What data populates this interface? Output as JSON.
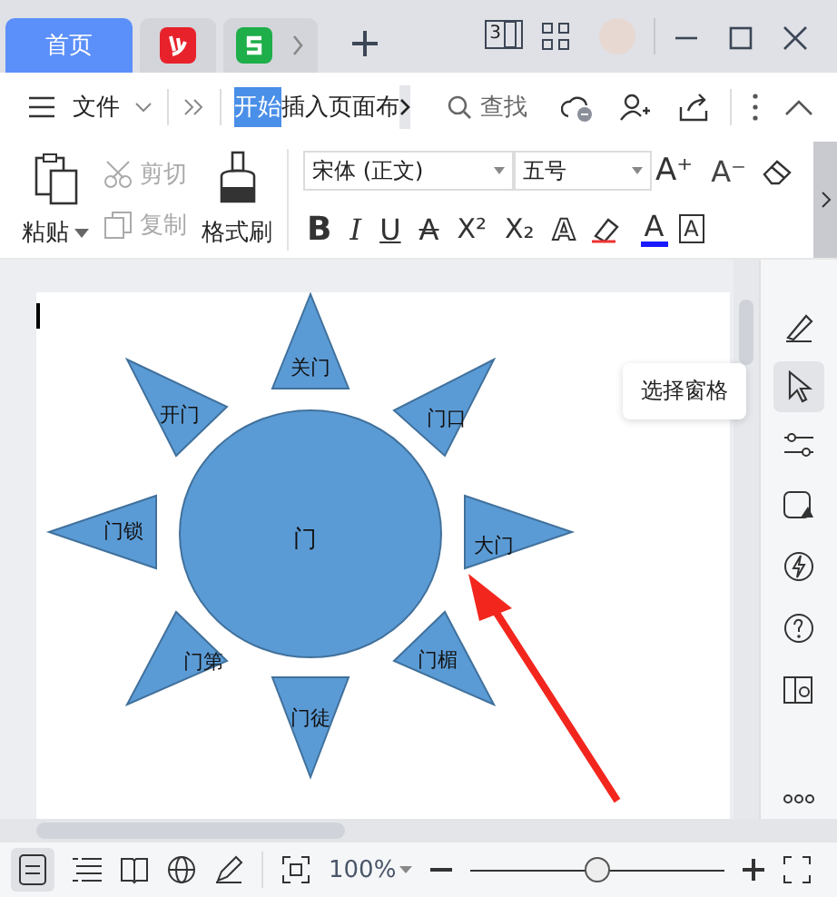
{
  "tab_bar": {
    "tabs": [
      {
        "kind": "label",
        "label": "首页",
        "selected": true
      },
      {
        "kind": "pdf",
        "selected": false
      },
      {
        "kind": "sheet",
        "selected": false
      }
    ],
    "device_count": "3"
  },
  "menu_bar": {
    "file_menu": "文件",
    "ribbon_tabs": [
      {
        "label": "开始",
        "selected": true
      },
      {
        "label": "插入",
        "selected": false
      },
      {
        "label": "页面布",
        "selected": false
      }
    ],
    "search": "查找"
  },
  "ribbon": {
    "paste": "粘贴",
    "cut": {
      "label": "剪切",
      "disabled": true
    },
    "copy": {
      "label": "复制",
      "disabled": true
    },
    "format_painter": "格式刷",
    "font": "宋体 (正文)",
    "font_size": "五号",
    "size_buttons": [
      {
        "kind": "grow",
        "glyph": "A⁺"
      },
      {
        "kind": "shrink",
        "glyph": "A⁻"
      }
    ],
    "format_buttons": [
      {
        "kind": "bold",
        "glyph": "B"
      },
      {
        "kind": "italic",
        "glyph": "I"
      },
      {
        "kind": "underline",
        "glyph": "U"
      },
      {
        "kind": "strike",
        "glyph": "A"
      },
      {
        "kind": "sup",
        "glyph": "X²"
      },
      {
        "kind": "sub",
        "glyph": "X₂"
      },
      {
        "kind": "effect",
        "glyph": "A"
      },
      {
        "kind": "highlight"
      },
      {
        "kind": "color",
        "glyph": "A"
      },
      {
        "kind": "border",
        "glyph": "A"
      }
    ]
  },
  "diagram": {
    "center": "门",
    "rays": [
      "关门",
      "门口",
      "大门",
      "门楣",
      "门徒",
      "门第",
      "门锁",
      "开门"
    ]
  },
  "tooltip": "选择窗格",
  "status_bar": {
    "zoom": "100%",
    "zoom_slider": {
      "level": 0.5
    }
  }
}
